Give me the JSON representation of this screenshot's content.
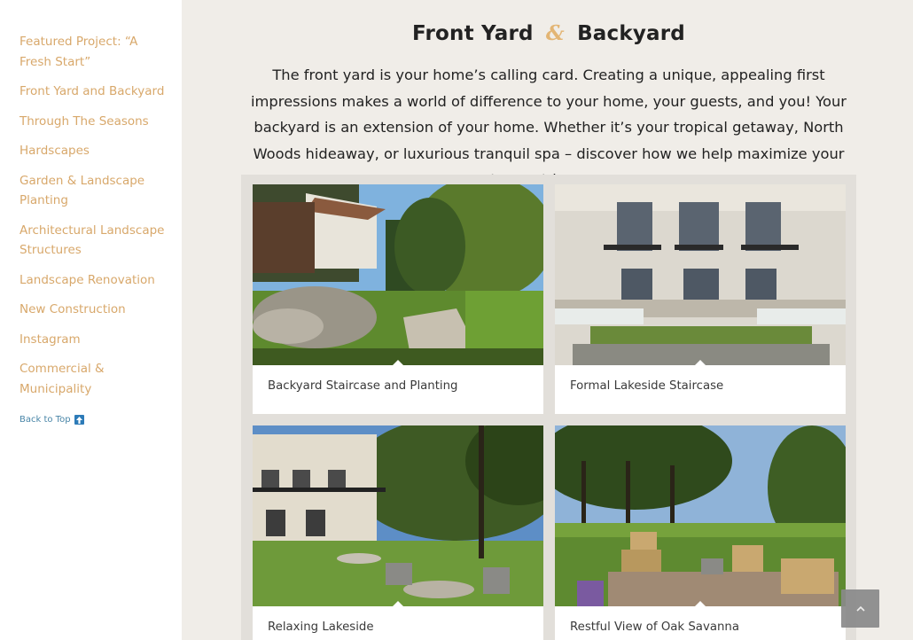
{
  "sidebar": {
    "items": [
      {
        "label": "Featured Project: “A Fresh Start”"
      },
      {
        "label": "Front Yard and Backyard"
      },
      {
        "label": "Through The Seasons"
      },
      {
        "label": "Hardscapes"
      },
      {
        "label": "Garden & Landscape Planting"
      },
      {
        "label": "Architectural Landscape Structures"
      },
      {
        "label": "Landscape Renovation"
      },
      {
        "label": "New Construction"
      },
      {
        "label": "Instagram"
      },
      {
        "label": "Commercial & Municipality"
      }
    ],
    "back_to_top": "Back to Top"
  },
  "main": {
    "title_left": "Front Yard",
    "title_amp": "&",
    "title_right": "Backyard",
    "intro": "The front yard is your home’s calling card. Creating a unique, appealing  first impressions makes a world of difference to your home, your guests, and you!  Your backyard is an extension of your home.  Whether it’s your tropical getaway, North Woods hideaway, or luxurious tranquil spa – discover how we help maximize your custom outdoor space.",
    "cards": [
      {
        "caption": "Backyard Staircase and Planting"
      },
      {
        "caption": "Formal Lakeside Staircase"
      },
      {
        "caption": "Relaxing Lakeside"
      },
      {
        "caption": "Restful View of Oak Savanna"
      }
    ]
  },
  "scroll_top_icon": "chevron-up-icon"
}
